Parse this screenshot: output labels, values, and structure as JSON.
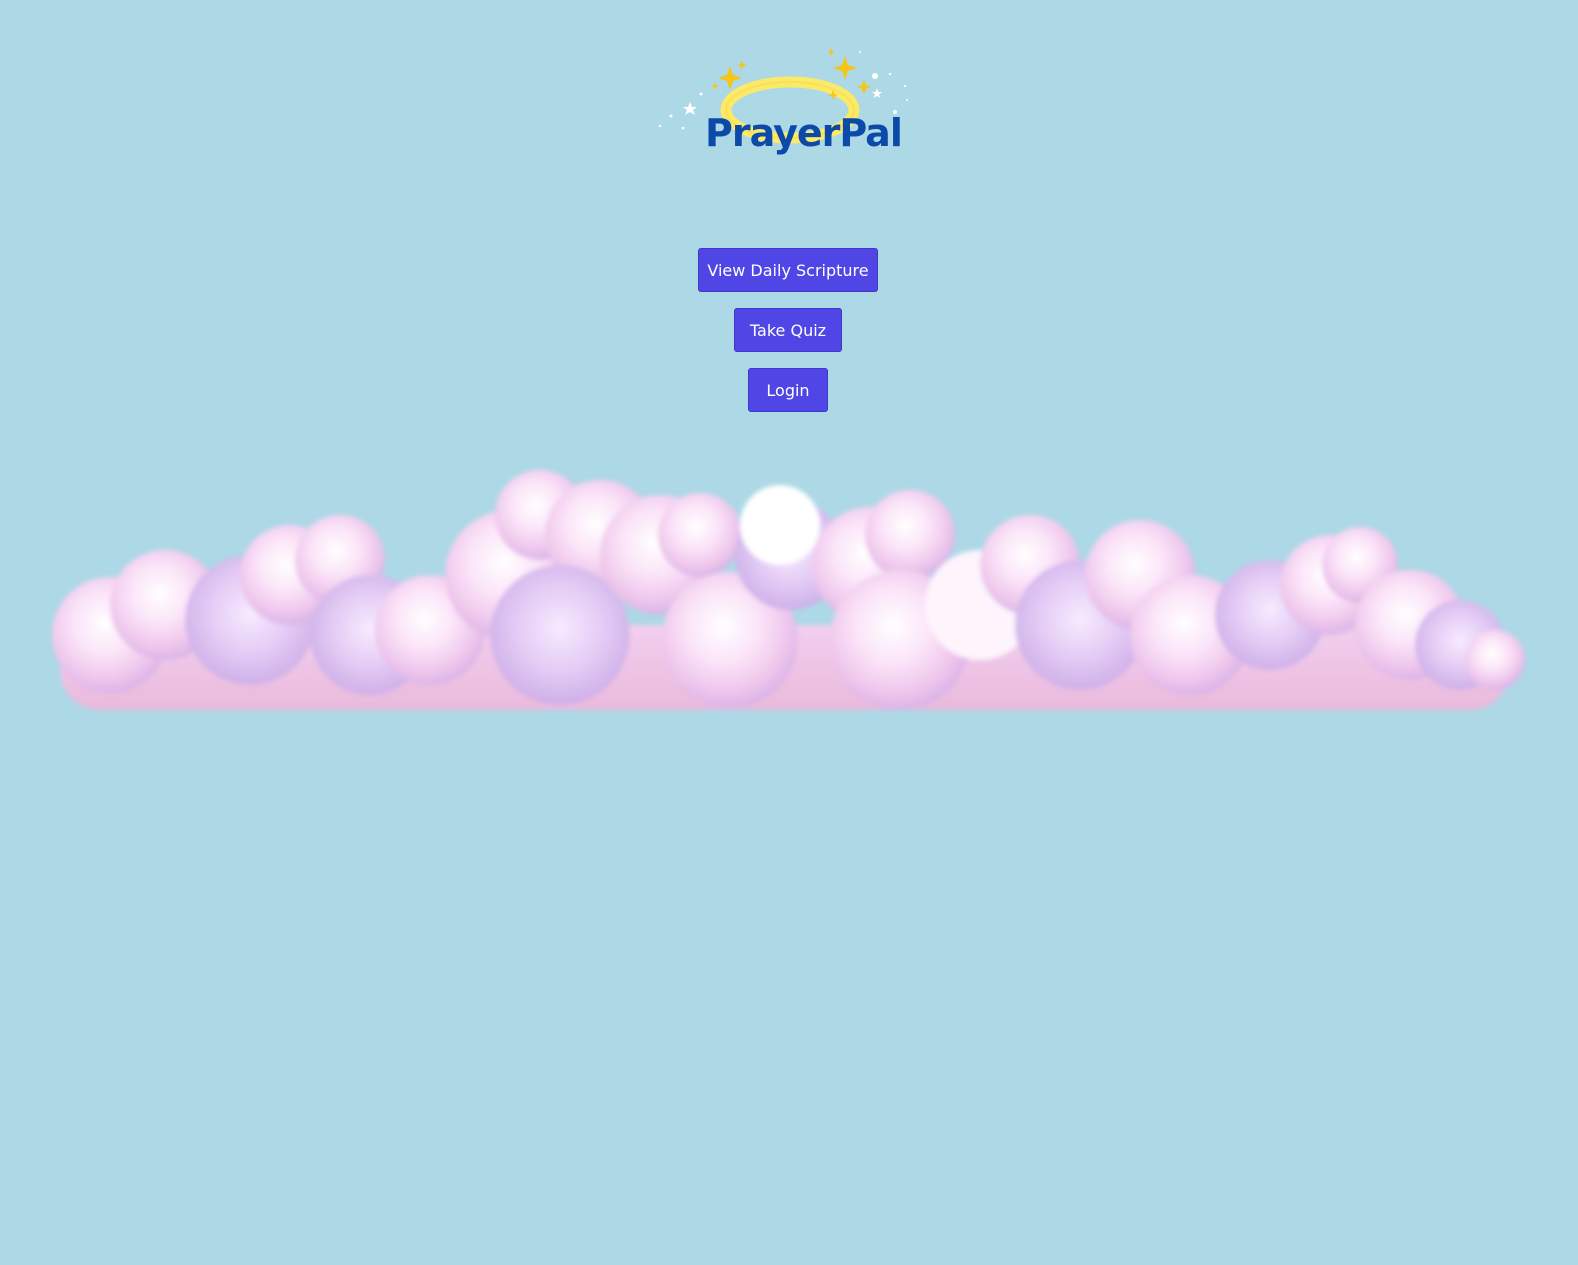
{
  "app": {
    "logo_text": "PrayerPal"
  },
  "nav": {
    "view_scripture_label": "View Daily Scripture",
    "take_quiz_label": "Take Quiz",
    "login_label": "Login"
  },
  "colors": {
    "background": "#add8e6",
    "button": "#4f46e5",
    "logo_text": "#0b4aa8",
    "halo": "#fbe96a",
    "sparkle": "#f5c518",
    "cloud": "#f6d9f2"
  },
  "icons": {
    "logo": "halo-logo-icon",
    "clouds": "pink-clouds-illustration"
  }
}
